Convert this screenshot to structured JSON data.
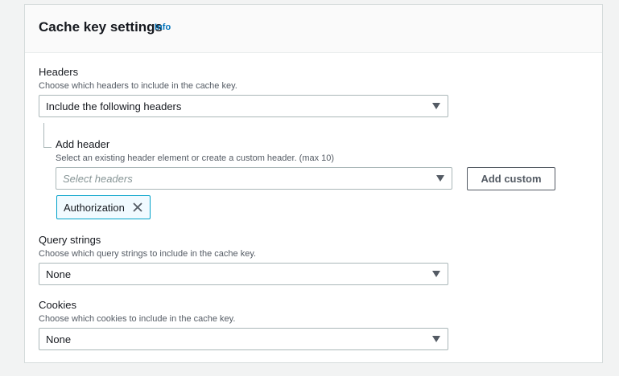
{
  "header": {
    "title": "Cache key settings",
    "info_label": "Info"
  },
  "headers": {
    "label": "Headers",
    "description": "Choose which headers to include in the cache key.",
    "selected": "Include the following headers"
  },
  "add_header": {
    "label": "Add header",
    "description": "Select an existing header element or create a custom header. (max 10)",
    "placeholder": "Select headers",
    "add_custom_label": "Add custom",
    "tokens": [
      "Authorization"
    ]
  },
  "query_strings": {
    "label": "Query strings",
    "description": "Choose which query strings to include in the cache key.",
    "selected": "None"
  },
  "cookies": {
    "label": "Cookies",
    "description": "Choose which cookies to include in the cache key.",
    "selected": "None"
  },
  "colors": {
    "link": "#0073bb",
    "token_border": "#00a1c9",
    "token_bg": "#f1faff"
  }
}
